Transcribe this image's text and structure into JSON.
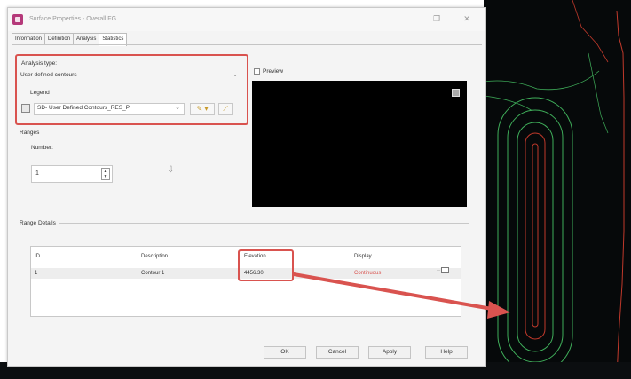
{
  "window": {
    "title": "Surface Properties - Overall FG",
    "app_icon": "civil3d-icon",
    "controls": [
      "minimize-icon",
      "maximize-icon",
      "close-icon"
    ]
  },
  "tabs": [
    {
      "label": "Information"
    },
    {
      "label": "Definition"
    },
    {
      "label": "Analysis"
    },
    {
      "label": "Statistics"
    }
  ],
  "analysis": {
    "type_label": "Analysis type:",
    "type_value": "User defined contours",
    "legend_label": "Legend",
    "legend_value": "SD- User Defined Contours_RES_P"
  },
  "ranges": {
    "label": "Ranges",
    "number_label": "Number:",
    "number_value": "1"
  },
  "preview": {
    "label": "Preview"
  },
  "range_details": {
    "label": "Range Details",
    "columns": [
      "ID",
      "Description",
      "Elevation",
      "Display"
    ],
    "rows": [
      {
        "id": "1",
        "description": "Contour 1",
        "elevation": "4456.30'",
        "display": "Continuous"
      }
    ]
  },
  "buttons": {
    "ok": "OK",
    "cancel": "Cancel",
    "apply": "Apply",
    "help": "Help"
  },
  "colors": {
    "highlight": "#d9534f",
    "contour_green": "#3fae5a",
    "contour_red": "#c0392b",
    "canvas": "#06090a"
  }
}
